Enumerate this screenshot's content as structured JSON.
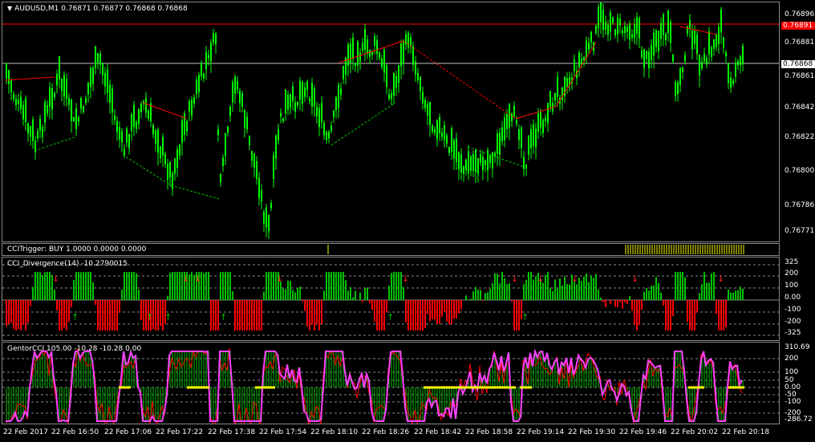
{
  "main": {
    "title": "AUDUSD,M1  0.76871 0.76877 0.76868 0.76868",
    "menu_arrow": "triangle-down-icon",
    "price_labels": [
      "0.76896",
      "0.76881",
      "0.76861",
      "0.76842",
      "0.76822",
      "0.76800",
      "0.76786",
      "0.76771"
    ],
    "red_line_label": "0.76891",
    "grey_line_label": "0.76868",
    "red_line_color": "#ff0000",
    "grey_line_color": "#c0c0c0",
    "candle_color": "#00ff00",
    "divergence_color": "#ff0000",
    "lower_divergence_color": "#00c000"
  },
  "trigger": {
    "title": "CCITrigger: BUY 1.0000 0.0000 0.0000",
    "bar_color": "#808000"
  },
  "cci": {
    "title": "CCI_Divergence(14) -10.2790015",
    "levels": [
      "325",
      "200",
      "100",
      "0.00",
      "-100",
      "-200",
      "-325"
    ],
    "positive_color": "#00c000",
    "negative_color": "#ff0000"
  },
  "gentor": {
    "title": "GentorCCI 105.00 -10.28 -10.28 0.00",
    "levels": [
      "310.69",
      "200",
      "100",
      "50",
      "0.00",
      "-50",
      "-100",
      "-200",
      "-286.72"
    ],
    "line_color": "#ff40ff",
    "signal_color": "#ff0000",
    "zero_color": "#ffff00",
    "hist_color": "#00c000"
  },
  "time_axis": [
    "22 Feb 2017",
    "22 Feb 16:50",
    "22 Feb 17:06",
    "22 Feb 17:22",
    "22 Feb 17:38",
    "22 Feb 17:54",
    "22 Feb 18:10",
    "22 Feb 18:26",
    "22 Feb 18:42",
    "22 Feb 18:58",
    "22 Feb 19:14",
    "22 Feb 19:30",
    "22 Feb 19:46",
    "22 Feb 20:02",
    "22 Feb 20:18"
  ]
}
